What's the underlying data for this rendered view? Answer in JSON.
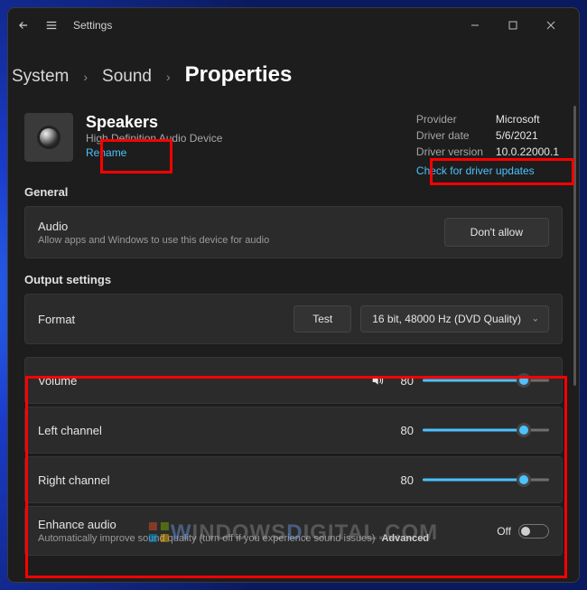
{
  "titlebar": {
    "title": "Settings"
  },
  "breadcrumb": {
    "a": "System",
    "b": "Sound",
    "c": "Properties"
  },
  "device": {
    "name": "Speakers",
    "description": "High Definition Audio Device",
    "rename_label": "Rename"
  },
  "driver": {
    "provider_label": "Provider",
    "provider_value": "Microsoft",
    "date_label": "Driver date",
    "date_value": "5/6/2021",
    "version_label": "Driver version",
    "version_value": "10.0.22000.1",
    "check_label": "Check for driver updates"
  },
  "sections": {
    "general": "General",
    "output": "Output settings"
  },
  "audio_card": {
    "title": "Audio",
    "sub": "Allow apps and Windows to use this device for audio",
    "button": "Don't allow"
  },
  "format_card": {
    "title": "Format",
    "test": "Test",
    "selected": "16 bit, 48000 Hz (DVD Quality)"
  },
  "sliders": {
    "volume": {
      "label": "Volume",
      "value": "80",
      "pct": 80
    },
    "left": {
      "label": "Left channel",
      "value": "80",
      "pct": 80
    },
    "right": {
      "label": "Right channel",
      "value": "80",
      "pct": 80
    }
  },
  "enhance": {
    "title": "Enhance audio",
    "sub": "Automatically improve sound quality (turn off if you experience sound issues)",
    "advanced": "Advanced",
    "state": "Off"
  },
  "watermark": {
    "a": "W",
    "b": "INDOWS",
    "c": "D",
    "d": "IGITAL",
    "e": ".COM"
  }
}
